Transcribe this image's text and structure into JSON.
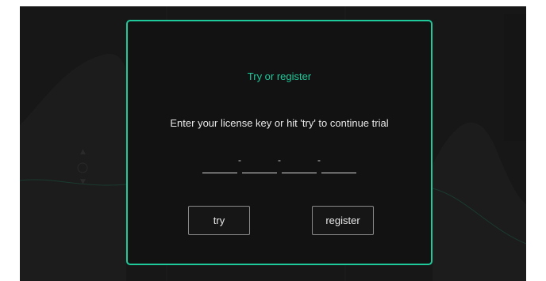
{
  "dialog": {
    "title": "Try or register",
    "message": "Enter your license key or hit 'try' to continue trial",
    "license_key": {
      "segments": [
        "",
        "",
        "",
        ""
      ],
      "separator": "-"
    },
    "try_label": "try",
    "register_label": "register"
  },
  "colors": {
    "accent": "#1fc99a",
    "window_background": "#171717",
    "dialog_background": "#121212",
    "button_border": "#8a8a8a",
    "text": "#e8e8e8"
  }
}
